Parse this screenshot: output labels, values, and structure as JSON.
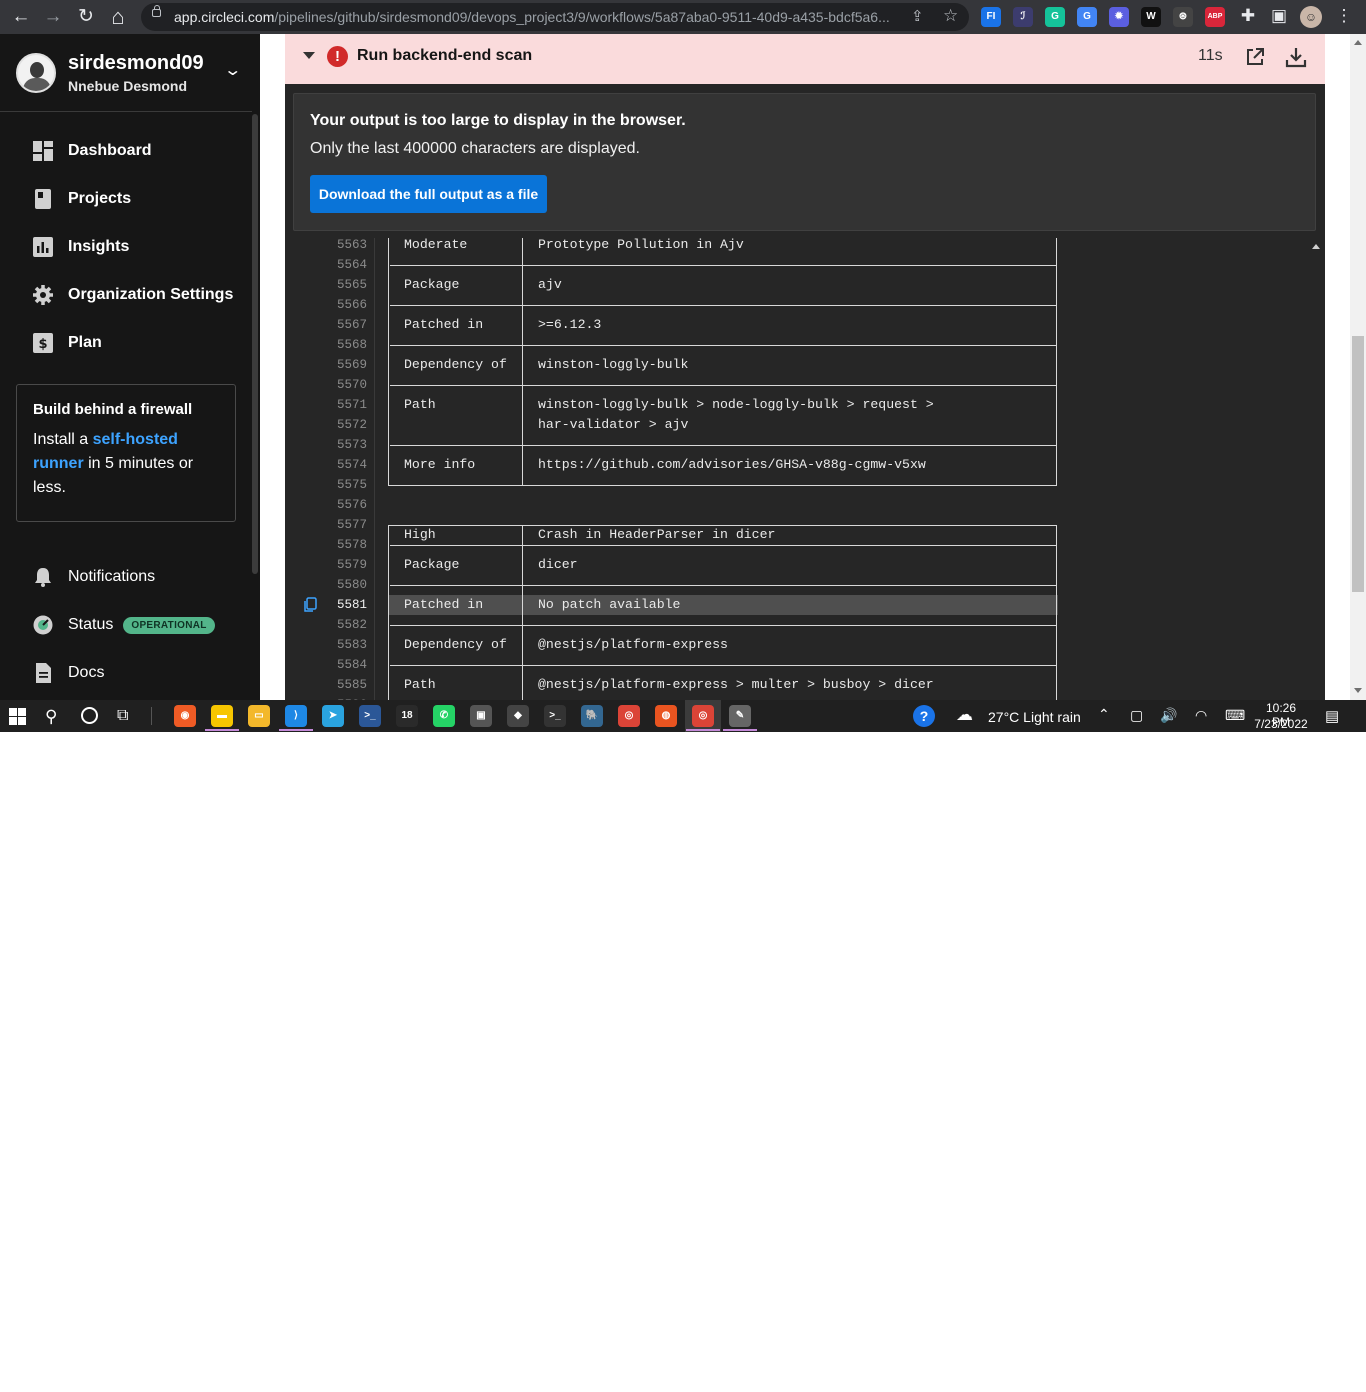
{
  "browser": {
    "url_host": "app.circleci.com",
    "url_path": "/pipelines/github/sirdesmond09/devops_project3/9/workflows/5a87aba0-9511-40d9-a435-bdcf5a6...",
    "nav": {
      "back": "←",
      "forward": "→",
      "reload": "↻",
      "home": "⌂"
    },
    "extensions": [
      {
        "name": "fi-extension-icon",
        "label": "FI",
        "color": "#1a73e8"
      },
      {
        "name": "writing-extension-icon",
        "label": "ℐ",
        "color": "#3c3c6e"
      },
      {
        "name": "grammarly-icon",
        "label": "G",
        "color": "#15c39a"
      },
      {
        "name": "translate-icon",
        "label": "G",
        "color": "#4285f4"
      },
      {
        "name": "gear-extension-icon",
        "label": "✹",
        "color": "#5b5fe0"
      },
      {
        "name": "w-extension-icon",
        "label": "W",
        "color": "#111111"
      },
      {
        "name": "openai-icon",
        "label": "⊛",
        "color": "#444444"
      },
      {
        "name": "adblock-plus-icon",
        "label": "ABP",
        "color": "#d9263a"
      }
    ]
  },
  "sidebar": {
    "username": "sirdesmond09",
    "full_name": "Nnebue Desmond",
    "nav": {
      "dashboard": "Dashboard",
      "projects": "Projects",
      "insights": "Insights",
      "org_settings": "Organization Settings",
      "plan": "Plan"
    },
    "promo": {
      "title": "Build behind a firewall",
      "text_before": "Install a ",
      "link": "self-hosted runner",
      "text_after": " in 5 minutes or less."
    },
    "notifications": "Notifications",
    "status": "Status",
    "status_badge": "OPERATIONAL",
    "docs": "Docs"
  },
  "step": {
    "title": "Run backend-end scan",
    "duration": "11s",
    "status_color": "#d12a2a"
  },
  "notice": {
    "title": "Your output is too large to display in the browser.",
    "subtitle": "Only the last 400000 characters are displayed.",
    "button": "Download the full output as a file"
  },
  "log": {
    "highlighted_line": "5581",
    "lines": [
      {
        "n": "5563",
        "c1": "Moderate",
        "c2": "Prototype Pollution in Ajv"
      },
      {
        "n": "5564",
        "sep": true
      },
      {
        "n": "5565",
        "c1": "Package",
        "c2": "ajv"
      },
      {
        "n": "5566",
        "sep": true
      },
      {
        "n": "5567",
        "c1": "Patched in",
        "c2": ">=6.12.3"
      },
      {
        "n": "5568",
        "sep": true
      },
      {
        "n": "5569",
        "c1": "Dependency of",
        "c2": "winston-loggly-bulk"
      },
      {
        "n": "5570",
        "sep": true
      },
      {
        "n": "5571",
        "c1": "Path",
        "c2": "winston-loggly-bulk > node-loggly-bulk > request >"
      },
      {
        "n": "5572",
        "c1": "",
        "c2": "har-validator > ajv"
      },
      {
        "n": "5573",
        "sep": true
      },
      {
        "n": "5574",
        "c1": "More info",
        "c2": "https://github.com/advisories/GHSA-v88g-cgmw-v5xw"
      },
      {
        "n": "5575",
        "bottom": true
      },
      {
        "n": "5576",
        "blank": true
      },
      {
        "n": "5577",
        "c1": "High",
        "c2": "Crash in HeaderParser in dicer",
        "top": true
      },
      {
        "n": "5578",
        "sep": true
      },
      {
        "n": "5579",
        "c1": "Package",
        "c2": "dicer"
      },
      {
        "n": "5580",
        "sep": true
      },
      {
        "n": "5581",
        "c1": "Patched in",
        "c2": "No patch available"
      },
      {
        "n": "5582",
        "sep": true
      },
      {
        "n": "5583",
        "c1": "Dependency of",
        "c2": "@nestjs/platform-express"
      },
      {
        "n": "5584",
        "sep": true
      },
      {
        "n": "5585",
        "c1": "Path",
        "c2": "@nestjs/platform-express > multer > busboy > dicer"
      },
      {
        "n": "5586",
        "sep": true
      }
    ]
  },
  "taskbar": {
    "apps": [
      {
        "name": "postman-icon",
        "label": "◉",
        "color": "#ef5b25"
      },
      {
        "name": "sticky-notes-icon",
        "label": "▬",
        "color": "#f7c600"
      },
      {
        "name": "file-explorer-icon",
        "label": "▭",
        "color": "#f3b82b"
      },
      {
        "name": "vscode-icon",
        "label": "⟩",
        "color": "#1e88e5"
      },
      {
        "name": "telegram-icon",
        "label": "➤",
        "color": "#2aa3df"
      },
      {
        "name": "powershell-icon",
        "label": ">_",
        "color": "#2b5797"
      },
      {
        "name": "app-18-icon",
        "label": "18",
        "color": "#2a2a2a"
      },
      {
        "name": "whatsapp-icon",
        "label": "✆",
        "color": "#25d366"
      },
      {
        "name": "remote-desktop-icon",
        "label": "▣",
        "color": "#555555"
      },
      {
        "name": "git-icon",
        "label": "◆",
        "color": "#444444"
      },
      {
        "name": "terminal-icon",
        "label": ">_",
        "color": "#333333"
      },
      {
        "name": "postgres-icon",
        "label": "🐘",
        "color": "#336791"
      },
      {
        "name": "chrome-icon",
        "label": "◎",
        "color": "#db4437"
      },
      {
        "name": "ubuntu-icon",
        "label": "◍",
        "color": "#e95420"
      },
      {
        "name": "chrome-active-icon",
        "label": "◎",
        "color": "#db4437"
      },
      {
        "name": "paint-icon",
        "label": "✎",
        "color": "#666666"
      }
    ],
    "weather": "27°C  Light rain",
    "time": "10:26 PM",
    "date": "7/23/2022"
  }
}
